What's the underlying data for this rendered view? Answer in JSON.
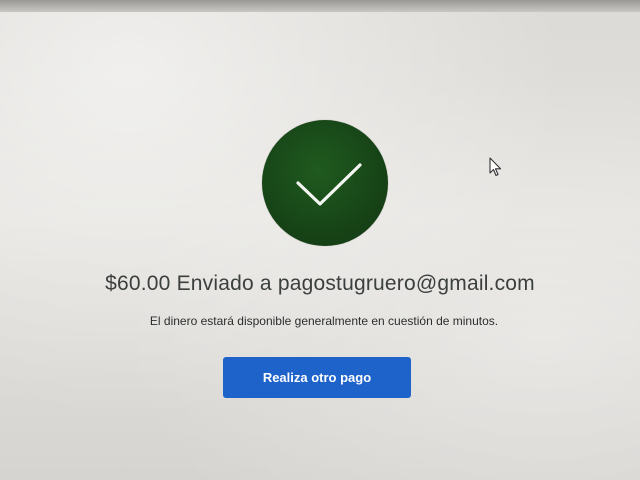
{
  "confirmation": {
    "amount": "$60.00",
    "headline": "$60.00 Enviado a pagostugruero@gmail.com",
    "recipient_email": "pagostugruero@gmail.com",
    "subtext": "El dinero estará disponible generalmente en cuestión de minutos.",
    "status_icon": "checkmark-icon"
  },
  "actions": {
    "new_payment_label": "Realiza otro pago"
  },
  "colors": {
    "success_circle": "#174417",
    "button": "#1e63c9"
  }
}
